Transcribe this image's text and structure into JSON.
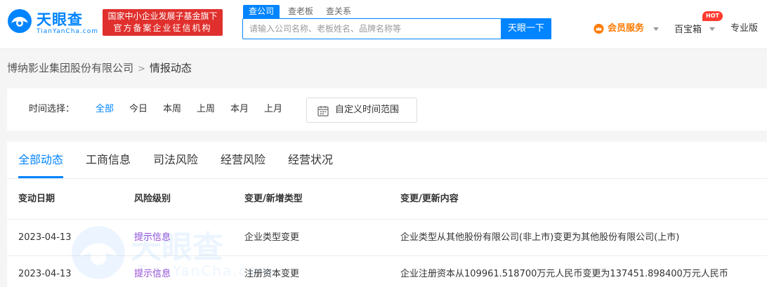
{
  "header": {
    "logo": {
      "name": "天眼查",
      "sub": "TianYanCha.com"
    },
    "badge": {
      "line1": "国家中小企业发展子基金旗下",
      "line2": "官方备案企业征信机构"
    },
    "search": {
      "tabs": [
        "查公司",
        "查老板",
        "查关系"
      ],
      "placeholder": "请输入公司名称、老板姓名、品牌名称等",
      "button": "天眼一下"
    },
    "vip_label": "会员服务",
    "treasure_label": "百宝箱",
    "hot_badge": "HOT",
    "pro_label": "专业版"
  },
  "breadcrumb": {
    "company": "博纳影业集团股份有限公司",
    "separator": ">",
    "current": "情报动态"
  },
  "time_filter": {
    "label": "时间选择：",
    "options": [
      "全部",
      "今日",
      "本周",
      "上周",
      "本月",
      "上月"
    ],
    "selected": "全部",
    "custom_range": "自定义时间范围"
  },
  "tabs": [
    "全部动态",
    "工商信息",
    "司法风险",
    "经营风险",
    "经营状况"
  ],
  "active_tab": "全部动态",
  "table": {
    "headers": [
      "变动日期",
      "风险级别",
      "变更/新增类型",
      "变更/更新内容"
    ],
    "rows": [
      [
        "2023-04-13",
        "提示信息",
        "企业类型变更",
        "企业类型从其他股份有限公司(非上市)变更为其他股份有限公司(上市)"
      ],
      [
        "2023-04-13",
        "提示信息",
        "注册资本变更",
        "企业注册资本从109961.518700万元人民币变更为137451.898400万元人民币"
      ]
    ]
  },
  "watermark": {
    "name": "天眼查",
    "sub": "TianYanCha.com"
  },
  "colors": {
    "primary": "#0084ff",
    "badge_red": "#e0302d",
    "vip_orange": "#ff7a00",
    "risk_purple": "#9b4fd6",
    "hot_red": "#ff3b30"
  }
}
